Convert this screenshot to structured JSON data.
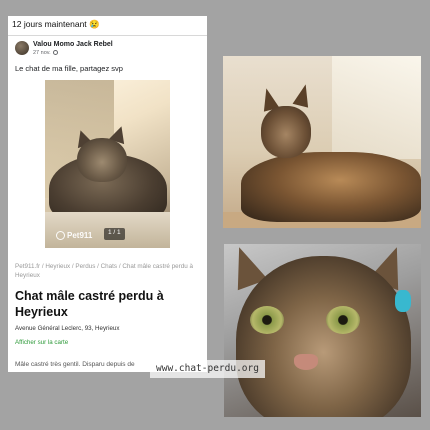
{
  "banner": {
    "text": "12 jours maintenant 😢"
  },
  "post": {
    "author": "Valou Momo Jack Rebel",
    "date": "27 nov.",
    "text": "Le chat de ma fille, partagez svp",
    "globe_icon": "globe-icon"
  },
  "listing": {
    "photo_logo": "Pet911",
    "photo_counter": "1 / 1",
    "breadcrumb": "Pet911.fr / Heyrieux / Perdus / Chats / Chat mâle castré perdu à Heyrieux",
    "title": "Chat mâle castré perdu à Heyrieux",
    "address": "Avenue Général Leclerc, 93, Heyrieux",
    "map_link": "Afficher sur la carte",
    "description": "Mâle castré très gentil. Disparu depuis de"
  },
  "watermark": {
    "text": "www.chat-perdu.org"
  },
  "colors": {
    "link_green": "#2e9a3a",
    "background": "#a3a3a3"
  }
}
